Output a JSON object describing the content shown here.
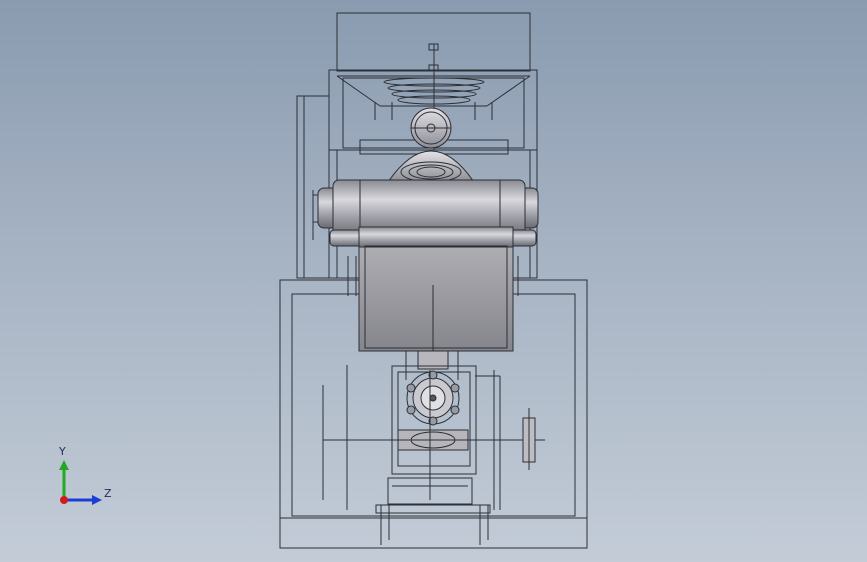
{
  "viewport": {
    "background_top": "#8a9bb0",
    "background_bottom": "#c3ccd7",
    "line_color": "#2b2f36"
  },
  "triad": {
    "y_label": "Y",
    "z_label": "Z",
    "y_color": "#22aa22",
    "z_color": "#1a3fd6",
    "x_color": "#d11a1a"
  }
}
